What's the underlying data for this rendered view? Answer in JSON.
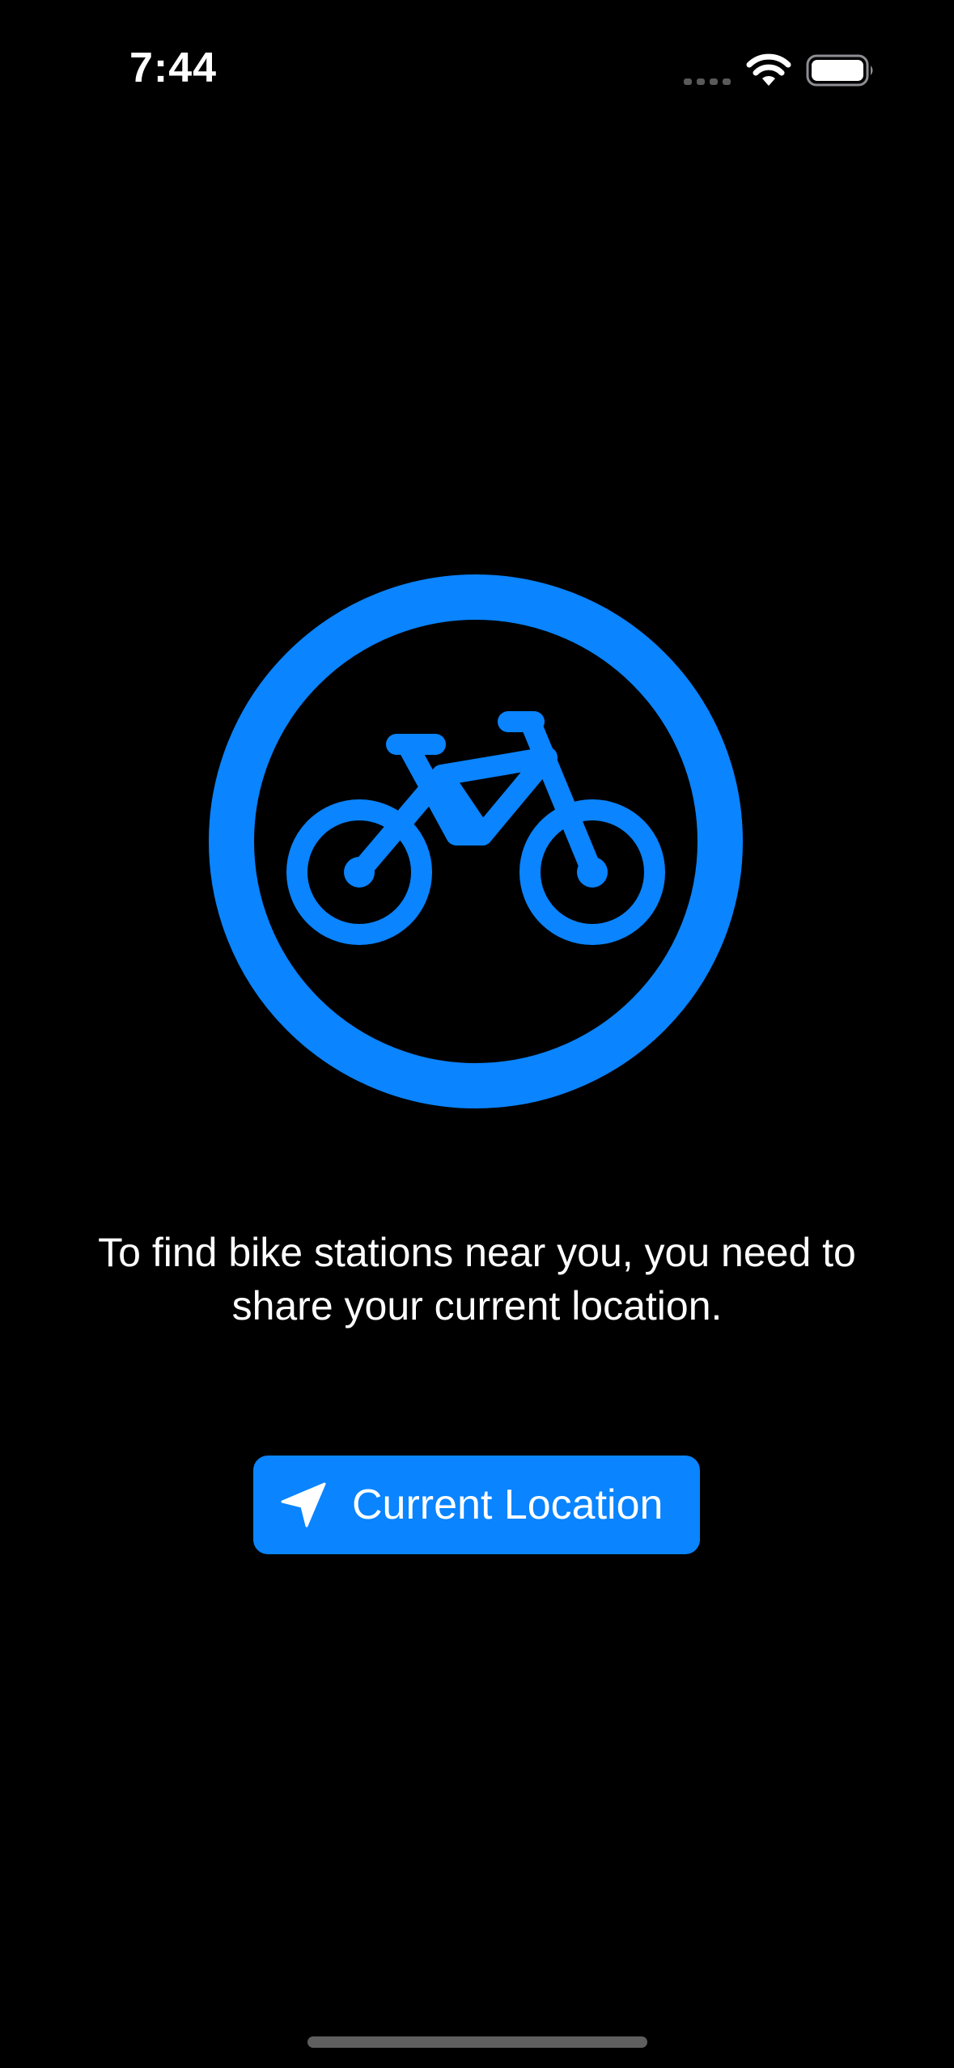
{
  "status_bar": {
    "time": "7:44",
    "icons": [
      "cellular-signal-icon",
      "wifi-icon",
      "battery-icon"
    ]
  },
  "hero": {
    "icon": "bicycle-circle-icon",
    "color": "#0a84ff"
  },
  "message": {
    "line1": "To find bike stations near you, you need to",
    "line2": "share your current location."
  },
  "location_button": {
    "icon": "location-arrow-icon",
    "label": "Current Location",
    "background": "#0a84ff"
  },
  "theme": {
    "background": "#000000",
    "text": "#ffffff",
    "accent": "#0a84ff"
  }
}
